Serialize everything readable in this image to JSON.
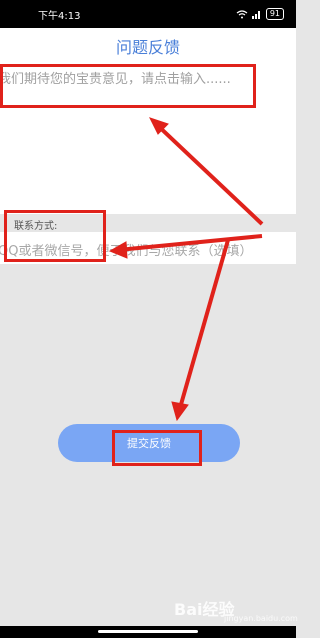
{
  "status_bar": {
    "time": "下午4:13",
    "icons": [
      "wifi-icon",
      "signal-icon"
    ],
    "battery": "91"
  },
  "header": {
    "title": "问题反馈"
  },
  "feedback": {
    "placeholder": "我们期待您的宝贵意见，请点击输入......"
  },
  "contact": {
    "label": "联系方式:",
    "placeholder": "QQ或者微信号，便于我们与您联系（选填）"
  },
  "submit": {
    "label": "提交反馈"
  },
  "annotation": {
    "color": "#e0221b"
  },
  "watermark": {
    "text": "Bai经验",
    "sub": "jingyan.baidu.com"
  },
  "colors": {
    "accent": "#4a7fd8",
    "button": "#7aa6f4",
    "background": "#e6e6e6"
  }
}
